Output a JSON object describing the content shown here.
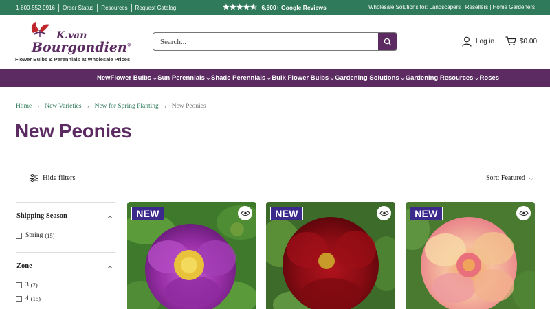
{
  "topbar": {
    "phone": "1-800-552-9916",
    "order_status": "Order Status",
    "resources": "Resources",
    "request_catalog": "Request Catalog",
    "rating": 4.5,
    "reviews": "6,600+ Google Reviews",
    "wholesale": "Wholesale Solutions for: Landscapers | Resellers | Home Gardeners"
  },
  "header": {
    "logo_line1": "K.van",
    "logo_line2": "Bourgondien",
    "logo_mark": "®",
    "tagline": "Flower Bulbs & Perennials at Wholesale Prices",
    "search_placeholder": "Search...",
    "login": "Log in",
    "cart_total": "$0.00"
  },
  "nav": {
    "items": [
      {
        "label": "New",
        "chevron": false
      },
      {
        "label": "Flower Bulbs",
        "chevron": true
      },
      {
        "label": "Sun Perennials",
        "chevron": true
      },
      {
        "label": "Shade Perennials",
        "chevron": true
      },
      {
        "label": "Bulk Flower Bulbs",
        "chevron": true
      },
      {
        "label": "Gardening Solutions",
        "chevron": true
      },
      {
        "label": "Gardening Resources",
        "chevron": true
      },
      {
        "label": "Roses",
        "chevron": false
      }
    ]
  },
  "breadcrumb": {
    "items": [
      "Home",
      "New Varieties",
      "New for Spring Planting"
    ],
    "current": "New Peonies"
  },
  "page": {
    "title": "New Peonies",
    "hide_filters": "Hide filters",
    "sort": "Sort: Featured"
  },
  "filters": {
    "shipping": {
      "title": "Shipping Season",
      "options": [
        {
          "label": "Spring",
          "count": "(15)"
        }
      ]
    },
    "zone": {
      "title": "Zone",
      "options": [
        {
          "label": "3",
          "count": "(7)"
        },
        {
          "label": "4",
          "count": "(15)"
        }
      ]
    }
  },
  "products": [
    {
      "badge": "NEW",
      "flower": "magenta"
    },
    {
      "badge": "NEW",
      "flower": "dark-red"
    },
    {
      "badge": "NEW",
      "flower": "peach-pink"
    }
  ],
  "colors": {
    "purple": "#5b2b62",
    "green": "#2e7a5a",
    "badge": "#3b2a8c"
  }
}
